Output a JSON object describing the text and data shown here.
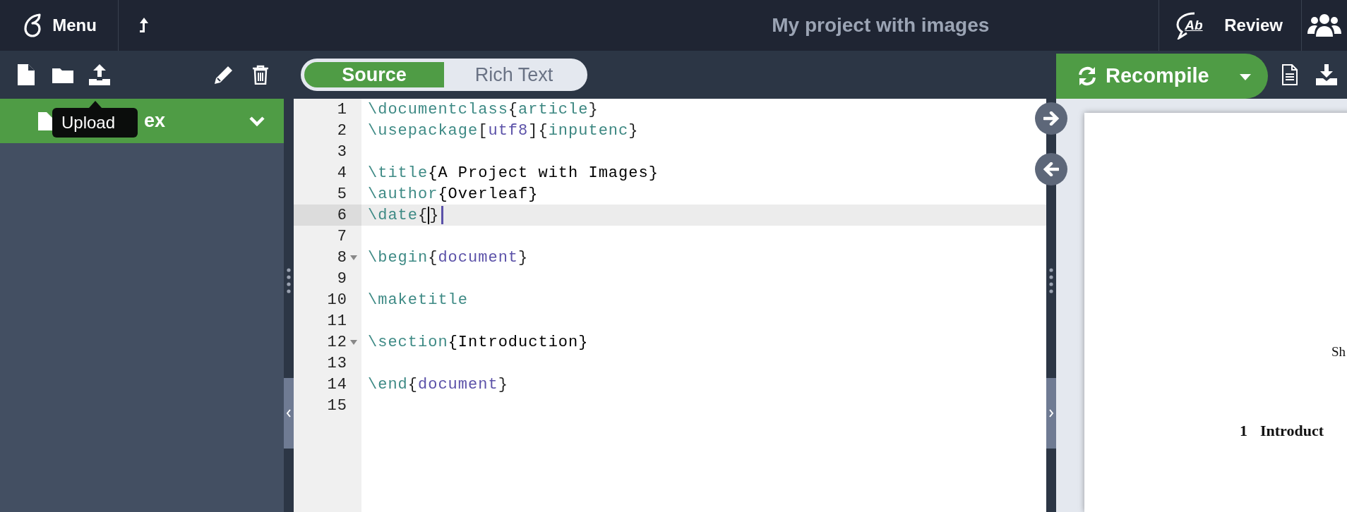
{
  "topbar": {
    "menu_label": "Menu",
    "title": "My project with images",
    "review_icon_text": "Ab",
    "review_label": "Review"
  },
  "file_toolbar": {
    "tooltip": "Upload"
  },
  "file_tree": {
    "items": [
      {
        "name": "ex",
        "selected": true,
        "expanded": true
      }
    ]
  },
  "editor": {
    "modes": [
      {
        "label": "Source",
        "selected": true
      },
      {
        "label": "Rich Text",
        "selected": false
      }
    ],
    "lines": [
      {
        "number": "1",
        "active": false,
        "caret": false,
        "foldable": false,
        "tokens": [
          {
            "text": "\\documentclass",
            "kind": "command"
          },
          {
            "text": "{",
            "kind": "brace"
          },
          {
            "text": "article",
            "kind": "argument"
          },
          {
            "text": "}",
            "kind": "brace"
          }
        ]
      },
      {
        "number": "2",
        "active": false,
        "caret": false,
        "foldable": false,
        "tokens": [
          {
            "text": "\\usepackage",
            "kind": "command"
          },
          {
            "text": "[",
            "kind": "brace"
          },
          {
            "text": "utf8",
            "kind": "option"
          },
          {
            "text": "]{",
            "kind": "brace"
          },
          {
            "text": "inputenc",
            "kind": "argument"
          },
          {
            "text": "}",
            "kind": "brace"
          }
        ]
      },
      {
        "number": "3",
        "active": false,
        "caret": false,
        "foldable": false
      },
      {
        "number": "4",
        "active": false,
        "caret": false,
        "foldable": false,
        "tokens": [
          {
            "text": "\\title",
            "kind": "command"
          },
          {
            "text": "{A Project with Images}",
            "kind": "text"
          }
        ]
      },
      {
        "number": "5",
        "active": false,
        "caret": false,
        "foldable": false,
        "tokens": [
          {
            "text": "\\author",
            "kind": "command"
          },
          {
            "text": "{Overleaf}",
            "kind": "text"
          }
        ]
      },
      {
        "number": "6",
        "active": true,
        "caret": true,
        "foldable": false,
        "tokens": [
          {
            "text": "\\date",
            "kind": "command"
          },
          {
            "text": "{",
            "kind": "brace"
          },
          {
            "text": "}",
            "kind": "brace"
          }
        ]
      },
      {
        "number": "7",
        "active": false,
        "caret": false,
        "foldable": false
      },
      {
        "number": "8",
        "active": false,
        "caret": false,
        "foldable": true,
        "tokens": [
          {
            "text": "\\begin",
            "kind": "command"
          },
          {
            "text": "{",
            "kind": "brace"
          },
          {
            "text": "document",
            "kind": "option"
          },
          {
            "text": "}",
            "kind": "brace"
          }
        ]
      },
      {
        "number": "9",
        "active": false,
        "caret": false,
        "foldable": false
      },
      {
        "number": "10",
        "active": false,
        "caret": false,
        "foldable": false,
        "tokens": [
          {
            "text": "\\maketitle",
            "kind": "command"
          }
        ]
      },
      {
        "number": "11",
        "active": false,
        "caret": false,
        "foldable": false
      },
      {
        "number": "12",
        "active": false,
        "caret": false,
        "foldable": true,
        "tokens": [
          {
            "text": "\\section",
            "kind": "command"
          },
          {
            "text": "{Introduction}",
            "kind": "text"
          }
        ]
      },
      {
        "number": "13",
        "active": false,
        "caret": false,
        "foldable": false
      },
      {
        "number": "14",
        "active": false,
        "caret": false,
        "foldable": false,
        "tokens": [
          {
            "text": "\\end",
            "kind": "command"
          },
          {
            "text": "{",
            "kind": "brace"
          },
          {
            "text": "document",
            "kind": "option"
          },
          {
            "text": "}",
            "kind": "brace"
          }
        ]
      },
      {
        "number": "15",
        "active": false,
        "caret": false,
        "foldable": false
      }
    ]
  },
  "pdf": {
    "recompile_label": "Recompile",
    "page_items": [
      {
        "kind": "fragment",
        "text": "Sh"
      },
      {
        "kind": "section",
        "number": "1",
        "title": "Introduct"
      }
    ]
  }
}
